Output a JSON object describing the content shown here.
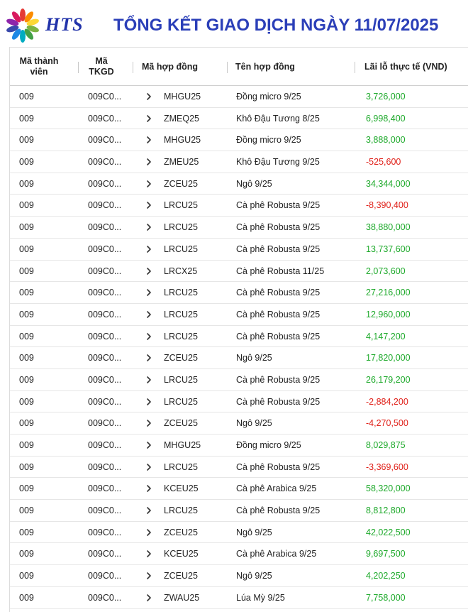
{
  "header": {
    "brand": "HTS",
    "title": "TỔNG KẾT GIAO DỊCH NGÀY 11/07/2025"
  },
  "table": {
    "columns": {
      "member": "Mã thành viên",
      "account": "Mã TKGD",
      "contract_code": "Mã hợp đồng",
      "contract_name": "Tên hợp đồng",
      "pnl": "Lãi lỗ thực tế (VND)"
    },
    "rows": [
      {
        "member": "009",
        "account": "009C0...",
        "code": "MHGU25",
        "name": "Đồng micro 9/25",
        "pnl": "3,726,000",
        "sign": "pos"
      },
      {
        "member": "009",
        "account": "009C0...",
        "code": "ZMEQ25",
        "name": "Khô Đậu Tương 8/25",
        "pnl": "6,998,400",
        "sign": "pos"
      },
      {
        "member": "009",
        "account": "009C0...",
        "code": "MHGU25",
        "name": "Đồng micro 9/25",
        "pnl": "3,888,000",
        "sign": "pos"
      },
      {
        "member": "009",
        "account": "009C0...",
        "code": "ZMEU25",
        "name": "Khô Đậu Tương 9/25",
        "pnl": "-525,600",
        "sign": "neg"
      },
      {
        "member": "009",
        "account": "009C0...",
        "code": "ZCEU25",
        "name": "Ngô 9/25",
        "pnl": "34,344,000",
        "sign": "pos"
      },
      {
        "member": "009",
        "account": "009C0...",
        "code": "LRCU25",
        "name": "Cà phê Robusta 9/25",
        "pnl": "-8,390,400",
        "sign": "neg"
      },
      {
        "member": "009",
        "account": "009C0...",
        "code": "LRCU25",
        "name": "Cà phê Robusta 9/25",
        "pnl": "38,880,000",
        "sign": "pos"
      },
      {
        "member": "009",
        "account": "009C0...",
        "code": "LRCU25",
        "name": "Cà phê Robusta 9/25",
        "pnl": "13,737,600",
        "sign": "pos"
      },
      {
        "member": "009",
        "account": "009C0...",
        "code": "LRCX25",
        "name": "Cà phê Robusta 11/25",
        "pnl": "2,073,600",
        "sign": "pos"
      },
      {
        "member": "009",
        "account": "009C0...",
        "code": "LRCU25",
        "name": "Cà phê Robusta 9/25",
        "pnl": "27,216,000",
        "sign": "pos"
      },
      {
        "member": "009",
        "account": "009C0...",
        "code": "LRCU25",
        "name": "Cà phê Robusta 9/25",
        "pnl": "12,960,000",
        "sign": "pos"
      },
      {
        "member": "009",
        "account": "009C0...",
        "code": "LRCU25",
        "name": "Cà phê Robusta 9/25",
        "pnl": "4,147,200",
        "sign": "pos"
      },
      {
        "member": "009",
        "account": "009C0...",
        "code": "ZCEU25",
        "name": "Ngô 9/25",
        "pnl": "17,820,000",
        "sign": "pos"
      },
      {
        "member": "009",
        "account": "009C0...",
        "code": "LRCU25",
        "name": "Cà phê Robusta 9/25",
        "pnl": "26,179,200",
        "sign": "pos"
      },
      {
        "member": "009",
        "account": "009C0...",
        "code": "LRCU25",
        "name": "Cà phê Robusta 9/25",
        "pnl": "-2,884,200",
        "sign": "neg"
      },
      {
        "member": "009",
        "account": "009C0...",
        "code": "ZCEU25",
        "name": "Ngô 9/25",
        "pnl": "-4,270,500",
        "sign": "neg"
      },
      {
        "member": "009",
        "account": "009C0...",
        "code": "MHGU25",
        "name": "Đồng micro 9/25",
        "pnl": "8,029,875",
        "sign": "pos"
      },
      {
        "member": "009",
        "account": "009C0...",
        "code": "LRCU25",
        "name": "Cà phê Robusta 9/25",
        "pnl": "-3,369,600",
        "sign": "neg"
      },
      {
        "member": "009",
        "account": "009C0...",
        "code": "KCEU25",
        "name": "Cà phê Arabica 9/25",
        "pnl": "58,320,000",
        "sign": "pos"
      },
      {
        "member": "009",
        "account": "009C0...",
        "code": "LRCU25",
        "name": "Cà phê Robusta 9/25",
        "pnl": "8,812,800",
        "sign": "pos"
      },
      {
        "member": "009",
        "account": "009C0...",
        "code": "ZCEU25",
        "name": "Ngô 9/25",
        "pnl": "42,022,500",
        "sign": "pos"
      },
      {
        "member": "009",
        "account": "009C0...",
        "code": "KCEU25",
        "name": "Cà phê Arabica 9/25",
        "pnl": "9,697,500",
        "sign": "pos"
      },
      {
        "member": "009",
        "account": "009C0...",
        "code": "ZCEU25",
        "name": "Ngô 9/25",
        "pnl": "4,202,250",
        "sign": "pos"
      },
      {
        "member": "009",
        "account": "009C0...",
        "code": "ZWAU25",
        "name": "Lúa Mỳ 9/25",
        "pnl": "7,758,000",
        "sign": "pos"
      }
    ]
  },
  "colors": {
    "title": "#2b3fb8",
    "positive": "#1faa2c",
    "negative": "#e0211a"
  }
}
